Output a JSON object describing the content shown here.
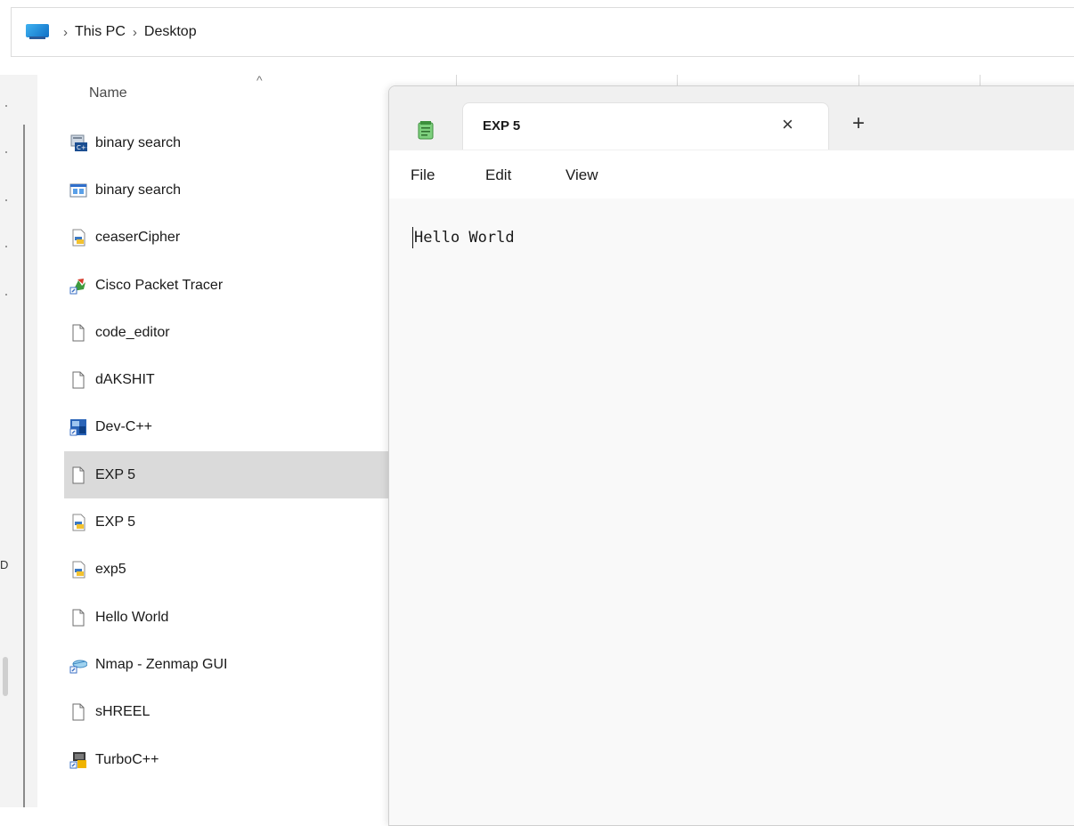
{
  "breadcrumb": {
    "items": [
      "This PC",
      "Desktop"
    ],
    "separator": "›"
  },
  "columns": {
    "name": "Name",
    "sort_indicator": "^"
  },
  "rail": {
    "glyph": "D"
  },
  "files": [
    {
      "name": "binary search",
      "icon": "c-source-file-icon"
    },
    {
      "name": "binary search",
      "icon": "executable-window-icon"
    },
    {
      "name": "ceaserCipher",
      "icon": "python-file-icon"
    },
    {
      "name": "Cisco Packet Tracer",
      "icon": "cisco-shortcut-icon"
    },
    {
      "name": "code_editor",
      "icon": "blank-file-icon"
    },
    {
      "name": "dAKSHIT",
      "icon": "blank-file-icon"
    },
    {
      "name": "Dev-C++",
      "icon": "devcpp-shortcut-icon"
    },
    {
      "name": "EXP 5",
      "icon": "blank-file-icon",
      "selected": true
    },
    {
      "name": "EXP 5",
      "icon": "python-file-icon"
    },
    {
      "name": "exp5",
      "icon": "python-file-icon"
    },
    {
      "name": "Hello World",
      "icon": "blank-file-icon"
    },
    {
      "name": "Nmap - Zenmap GUI",
      "icon": "nmap-shortcut-icon"
    },
    {
      "name": "sHREEL",
      "icon": "blank-file-icon"
    },
    {
      "name": "TurboC++",
      "icon": "turboc-shortcut-icon"
    }
  ],
  "notepad": {
    "tab_title": "EXP 5",
    "close_glyph": "×",
    "new_tab_glyph": "+",
    "menu": [
      "File",
      "Edit",
      "View"
    ],
    "content": "Hello World"
  },
  "colors": {
    "selection": "#dadada",
    "window_bg": "#f9f9f9"
  }
}
